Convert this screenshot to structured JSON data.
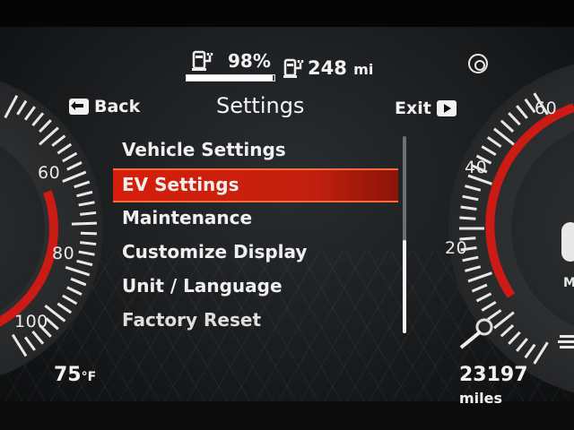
{
  "status": {
    "battery_percent_label": "98%",
    "battery_level": 0.98,
    "range_value": "248",
    "range_unit": "mi"
  },
  "header": {
    "back_label": "Back",
    "title": "Settings",
    "exit_label": "Exit"
  },
  "menu": {
    "items": [
      {
        "label": "Vehicle Settings"
      },
      {
        "label": "EV Settings"
      },
      {
        "label": "Maintenance"
      },
      {
        "label": "Customize Display"
      },
      {
        "label": "Unit / Language"
      },
      {
        "label": "Factory Reset"
      }
    ],
    "selected_index": 1
  },
  "left_gauge": {
    "ticks": [
      "60",
      "80",
      "100"
    ]
  },
  "right_gauge": {
    "ticks": [
      "60",
      "40",
      "20"
    ]
  },
  "footer": {
    "temperature_value": "75",
    "temperature_unit": "°F",
    "odometer_value": "23197",
    "odometer_unit": "miles"
  },
  "right_edge": {
    "partial_text": "M"
  },
  "colors": {
    "accent_red": "#d61f0a",
    "highlight_border": "#ff6a3a",
    "text": "#f2f2f2"
  },
  "icons": {
    "charger": "charger-plug-icon",
    "range": "charger-range-icon",
    "back": "back-arrow-icon",
    "exit": "exit-arrow-icon",
    "driver": "driver-profile-icon",
    "odometer_end": "lines-icon"
  }
}
